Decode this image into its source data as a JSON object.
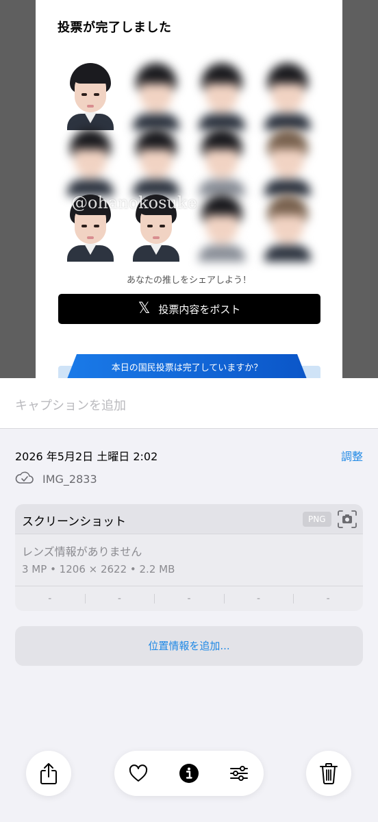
{
  "photo": {
    "title": "投票が完了しました",
    "watermark": "@ohanokosuke",
    "share_prompt": "あなたの推しをシェアしよう！",
    "post_button_label": "投票内容をポスト",
    "post_button_icon": "x-logo-icon",
    "banner_text": "本日の国民投票は完了していますか？",
    "banner_color": "#0b56c8"
  },
  "caption": {
    "placeholder": "キャプションを追加"
  },
  "info": {
    "date": "2026 年5月2日 土曜日 2:02",
    "adjust_label": "調整",
    "filename": "IMG_2833",
    "accent_color": "#1e88e5"
  },
  "card": {
    "title": "スクリーンショット",
    "format_badge": "PNG",
    "lens": "レンズ情報がありません",
    "specs": "3 MP • 1206 × 2622 • 2.2 MB",
    "exif": [
      "-",
      "-",
      "-",
      "-",
      "-"
    ]
  },
  "location": {
    "label": "位置情報を追加..."
  },
  "toolbar": {
    "icons": [
      "share-icon",
      "heart-icon",
      "info-icon",
      "adjust-icon",
      "trash-icon"
    ]
  }
}
